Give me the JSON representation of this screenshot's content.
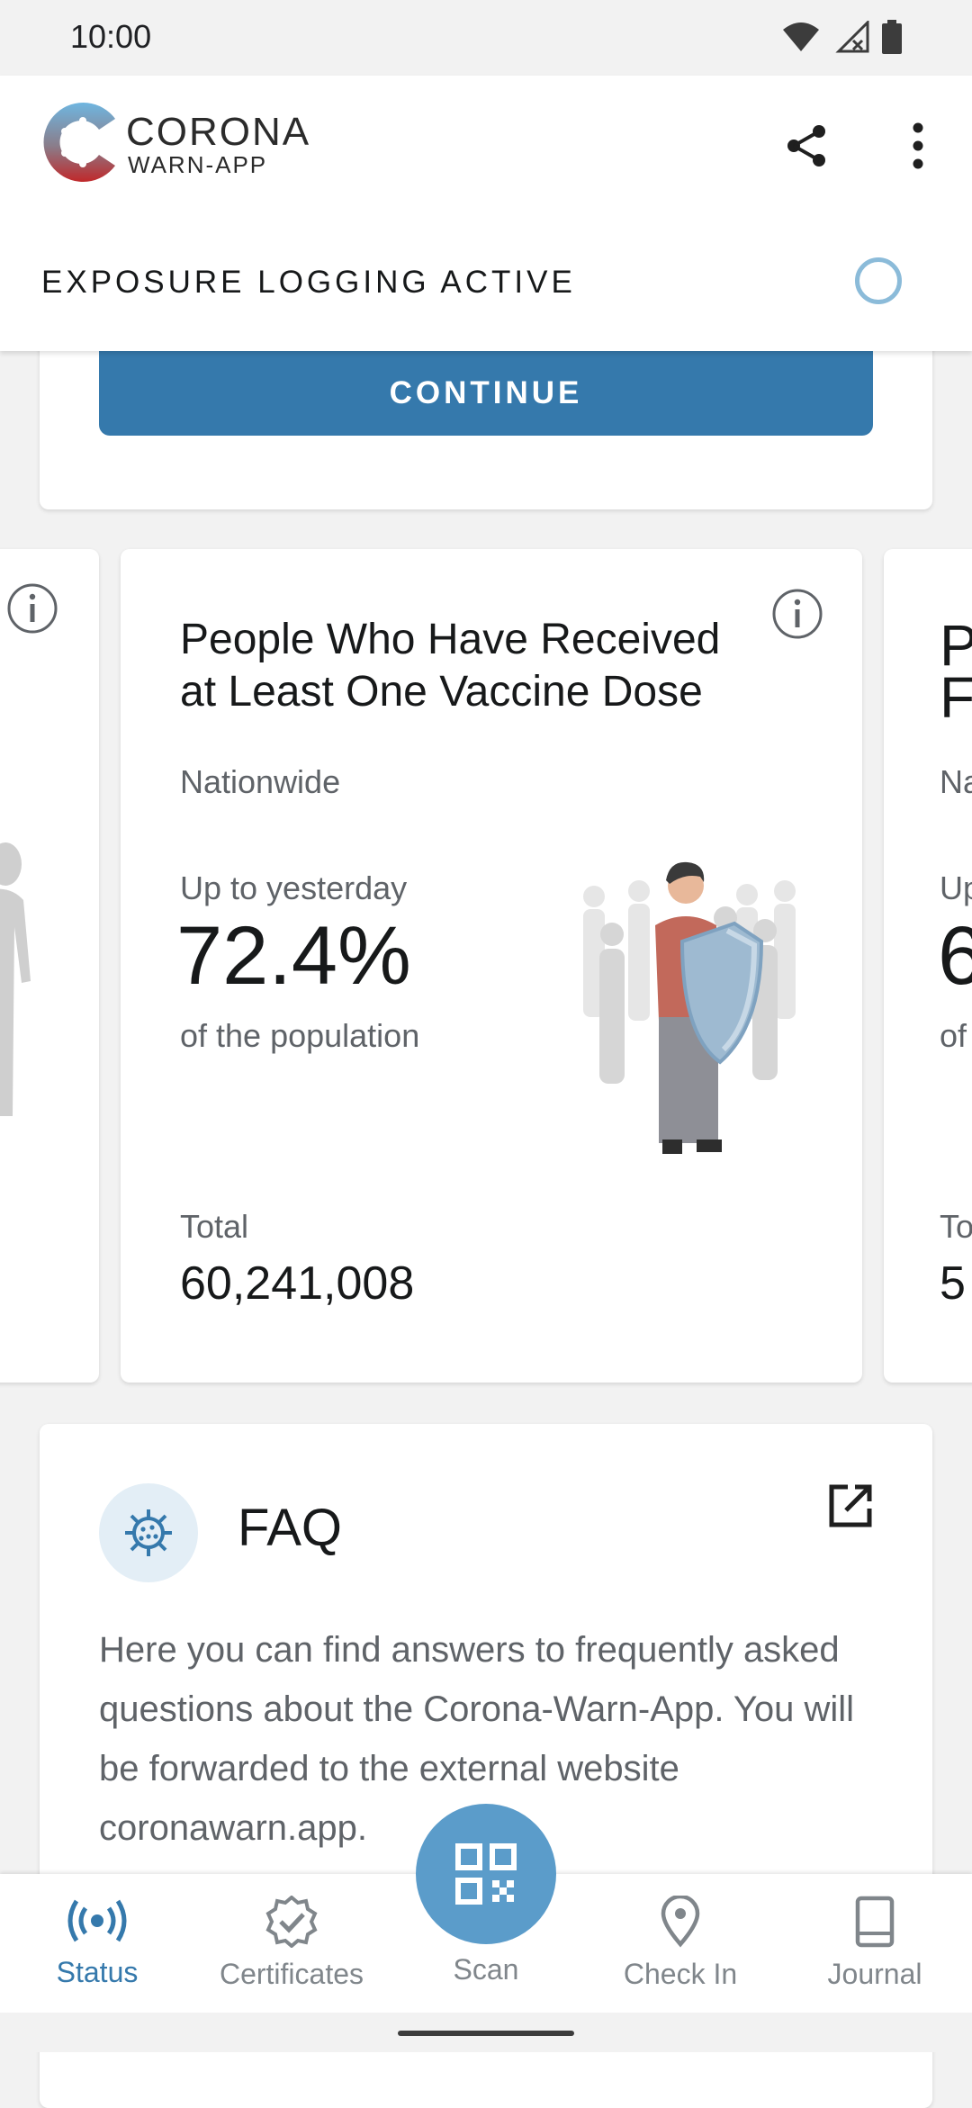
{
  "status_bar": {
    "time": "10:00"
  },
  "header": {
    "app_name_line1": "CORONA",
    "app_name_line2": "WARN-APP",
    "exposure_status": "EXPOSURE LOGGING ACTIVE"
  },
  "top_card": {
    "continue_label": "CONTINUE"
  },
  "stats_card": {
    "title": "People Who Have Received at Least One Vaccine Dose",
    "region": "Nationwide",
    "period": "Up to yesterday",
    "value": "72.4%",
    "value_caption": "of the population",
    "total_label": "Total",
    "total_value": "60,241,008"
  },
  "right_peek": {
    "title_1": "P",
    "title_2": "F",
    "region": "Na",
    "period": "Up",
    "value": "6",
    "caption": "of",
    "total_label": "To",
    "total": "5"
  },
  "faq": {
    "title": "FAQ",
    "text": "Here you can find answers to frequently asked questions about the Corona-Warn-App. You will be forwarded to the external website coronawarn.app."
  },
  "bottom_nav": {
    "items": [
      {
        "label": "Status",
        "icon": "broadcast-icon",
        "active": true
      },
      {
        "label": "Certificates",
        "icon": "certificate-icon",
        "active": false
      },
      {
        "label": "Scan",
        "icon": "qr-code-icon",
        "active": false
      },
      {
        "label": "Check In",
        "icon": "location-pin-icon",
        "active": false
      },
      {
        "label": "Journal",
        "icon": "book-icon",
        "active": false
      }
    ]
  },
  "colors": {
    "accent": "#3579ac",
    "fab": "#5b9cca",
    "ring": "#8bbbd9",
    "text_secondary": "#5f6368"
  }
}
